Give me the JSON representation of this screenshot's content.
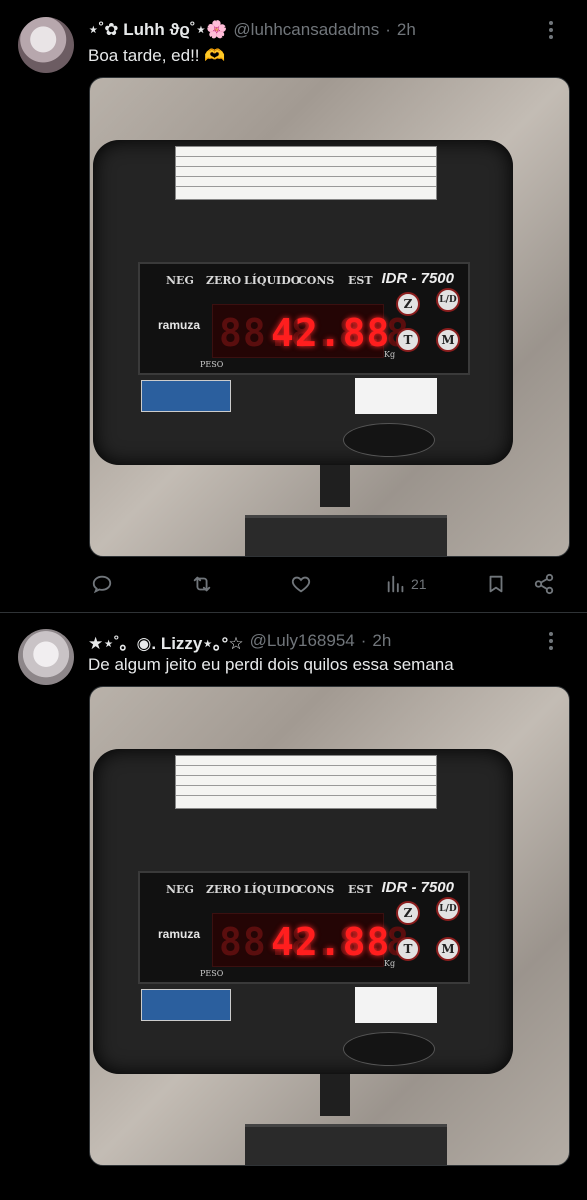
{
  "posts": [
    {
      "display_name": "⋆˚✿ Luhh ϑϱ˚⋆🌸",
      "handle": "@luhhcansadadms",
      "dot": "·",
      "time": "2h",
      "text": "Boa tarde, ed!! 🫶",
      "views": "21",
      "media": {
        "plate_text": "Máx 200 kg · Mín 1 kg · e=d 50 g",
        "panel_annunciators": [
          "NEG",
          "ZERO",
          "LÍQUIDO",
          "CONS",
          "EST"
        ],
        "model": "IDR - 7500",
        "brand": "ramuza",
        "display_digits": "42.88",
        "display_ghost": "88.8.8.8",
        "buttons": [
          "Z",
          "L/D",
          "T",
          "M"
        ],
        "peso": "PESO",
        "kg": "Kg"
      }
    },
    {
      "display_name": "★⋆˚。◉. Lizzy⋆｡°☆",
      "handle": "@Luly168954",
      "dot": "·",
      "time": "2h",
      "text": "De algum jeito eu perdi dois quilos essa semana",
      "media": {
        "plate_text": "Máx 200 kg · Mín 1 kg · e=d 50 g",
        "panel_annunciators": [
          "NEG",
          "ZERO",
          "LÍQUIDO",
          "CONS",
          "EST"
        ],
        "model": "IDR - 7500",
        "brand": "ramuza",
        "display_digits": "42.88",
        "display_ghost": "88.8.8.8",
        "buttons": [
          "Z",
          "L/D",
          "T",
          "M"
        ],
        "peso": "PESO",
        "kg": "Kg"
      }
    }
  ],
  "icons": {
    "more": "more-vertical-icon",
    "reply": "reply-icon",
    "retweet": "retweet-icon",
    "like": "heart-icon",
    "views": "views-icon",
    "bookmark": "bookmark-icon",
    "share": "share-icon"
  },
  "colors": {
    "background": "#000000",
    "text": "#e7e9ea",
    "muted": "#71767b",
    "divider": "#2f3336",
    "led": "#ff1e1e"
  }
}
